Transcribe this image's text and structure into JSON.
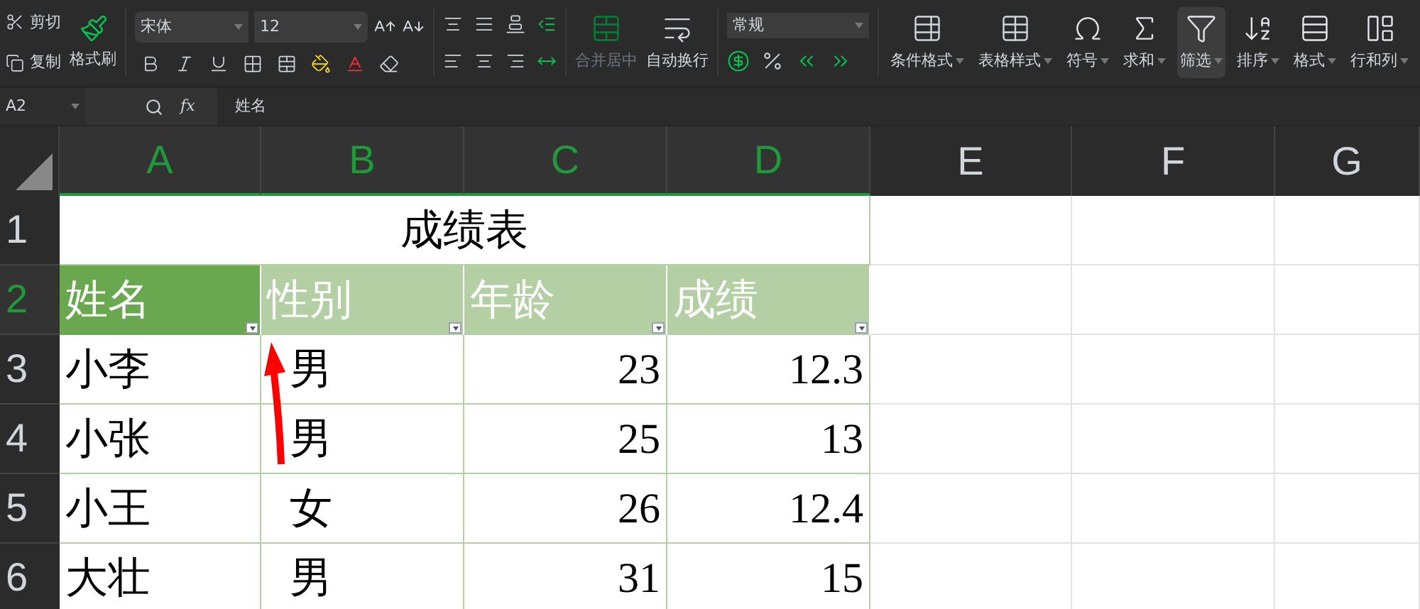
{
  "toolbar": {
    "clipboard": [
      {
        "label": "剪切"
      },
      {
        "label": "复制"
      }
    ],
    "format_painter": "格式刷",
    "font_name": "宋体",
    "font_size": "12",
    "merge_center": {
      "label": "合并居中",
      "disabled": true
    },
    "wrap_text": {
      "label": "自动换行",
      "disabled": false
    },
    "number_format": "常规",
    "ribbon_buttons": [
      {
        "label": "条件格式",
        "selected": false
      },
      {
        "label": "表格样式",
        "selected": false
      },
      {
        "label": "符号",
        "selected": false
      },
      {
        "label": "求和",
        "selected": false
      },
      {
        "label": "筛选",
        "selected": true
      },
      {
        "label": "排序",
        "selected": false
      },
      {
        "label": "格式",
        "selected": false
      },
      {
        "label": "行和列",
        "selected": false
      }
    ]
  },
  "formula_bar": {
    "cell_ref": "A2",
    "fx": "fx",
    "value": "姓名"
  },
  "sheet": {
    "columns": [
      {
        "label": "A",
        "selected": true
      },
      {
        "label": "B",
        "selected": true
      },
      {
        "label": "C",
        "selected": true
      },
      {
        "label": "D",
        "selected": true
      },
      {
        "label": "E",
        "selected": false
      },
      {
        "label": "F",
        "selected": false
      },
      {
        "label": "G",
        "selected": false
      }
    ],
    "rows": [
      {
        "label": "1",
        "selected": false
      },
      {
        "label": "2",
        "selected": true
      },
      {
        "label": "3",
        "selected": false
      },
      {
        "label": "4",
        "selected": false
      },
      {
        "label": "5",
        "selected": false
      },
      {
        "label": "6",
        "selected": false
      }
    ],
    "title": "成绩表",
    "headers": [
      {
        "text": "姓名",
        "selected": true,
        "filter": true
      },
      {
        "text": "性别",
        "selected": false,
        "filter": true
      },
      {
        "text": "年龄",
        "selected": false,
        "filter": true
      },
      {
        "text": "成绩",
        "selected": false,
        "filter": true
      }
    ],
    "data": [
      [
        "小李",
        "男",
        "23",
        "12.3"
      ],
      [
        "小张",
        "男",
        "25",
        "13"
      ],
      [
        "小王",
        "女",
        "26",
        "12.4"
      ],
      [
        "大壮",
        "男",
        "31",
        "15"
      ]
    ]
  }
}
